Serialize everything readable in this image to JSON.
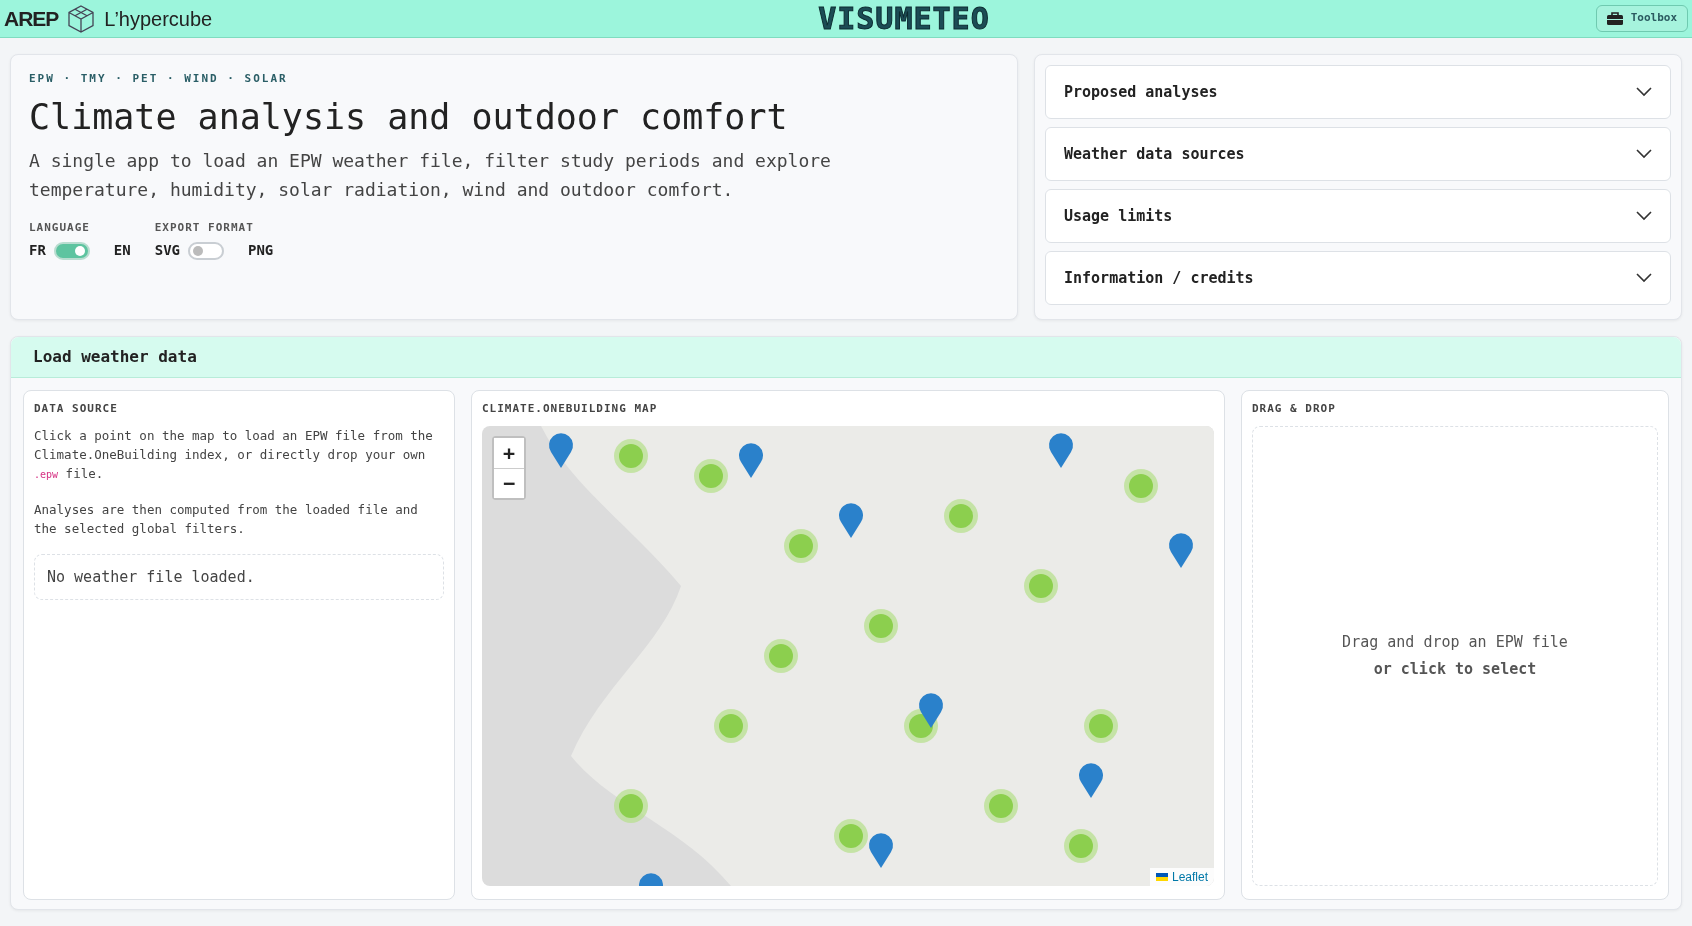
{
  "header": {
    "brand": "AREP",
    "sub_brand": "L’hypercube",
    "app_title": "VISUMETEO",
    "toolbox_button": "Toolbox"
  },
  "hero": {
    "tags": "EPW · TMY · PET · WIND · SOLAR",
    "title": "Climate analysis and outdoor comfort",
    "description": "A single app to load an EPW weather file, filter study periods and explore temperature, humidity, solar radiation, wind and outdoor comfort.",
    "switches": [
      {
        "label": "LANGUAGE",
        "left": "FR",
        "right": "EN",
        "on": true
      },
      {
        "label": "EXPORT FORMAT",
        "left": "SVG",
        "right": "PNG",
        "on": false
      }
    ]
  },
  "accordion": [
    {
      "title": "Proposed analyses",
      "expanded": false
    },
    {
      "title": "Weather data sources",
      "expanded": false
    },
    {
      "title": "Usage limits",
      "expanded": false
    },
    {
      "title": "Information / credits",
      "expanded": false
    }
  ],
  "load_section": {
    "title": "Load weather data",
    "data_source": {
      "heading": "DATA SOURCE",
      "paragraph_1": "Click a point on the map to load an EPW file from the Climate.OneBuilding index, or directly drop your own",
      "code": ".epw",
      "paragraph_1_end": "file.",
      "paragraph_2": "Analyses are then computed from the loaded file and the selected global filters.",
      "status": "No weather file loaded."
    },
    "map": {
      "heading": "CLIMATE.ONEBUILDING MAP",
      "zoom_in": "+",
      "zoom_out": "−",
      "attribution": "Leaflet"
    },
    "drop": {
      "heading": "DRAG & DROP",
      "line_1": "Drag and drop an EPW file",
      "line_2": "or click to select"
    }
  }
}
